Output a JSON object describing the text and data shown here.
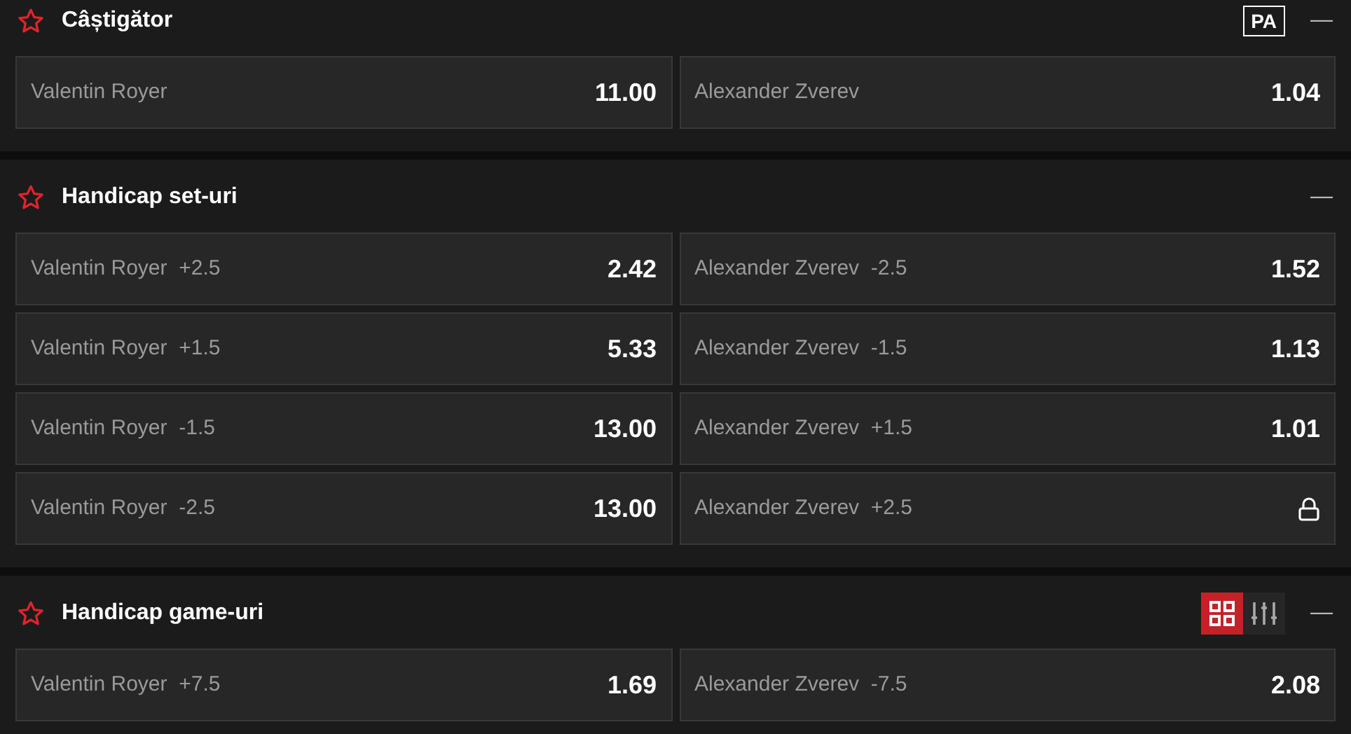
{
  "markets": [
    {
      "title": "Câștigător",
      "badge": "PA",
      "collapse": "—",
      "outcomes": [
        {
          "kind": "odds",
          "name": "Valentin Royer",
          "odds": "11.00"
        },
        {
          "kind": "odds",
          "name": "Alexander Zverev",
          "odds": "1.04"
        }
      ]
    },
    {
      "title": "Handicap set-uri",
      "collapse": "—",
      "outcomes": [
        {
          "kind": "odds",
          "name": "Valentin Royer",
          "line": "+2.5",
          "odds": "2.42"
        },
        {
          "kind": "odds",
          "name": "Alexander Zverev",
          "line": "-2.5",
          "odds": "1.52"
        },
        {
          "kind": "odds",
          "name": "Valentin Royer",
          "line": "+1.5",
          "odds": "5.33"
        },
        {
          "kind": "odds",
          "name": "Alexander Zverev",
          "line": "-1.5",
          "odds": "1.13"
        },
        {
          "kind": "odds",
          "name": "Valentin Royer",
          "line": "-1.5",
          "odds": "13.00"
        },
        {
          "kind": "odds",
          "name": "Alexander Zverev",
          "line": "+1.5",
          "odds": "1.01"
        },
        {
          "kind": "odds",
          "name": "Valentin Royer",
          "line": "-2.5",
          "odds": "13.00"
        },
        {
          "kind": "locked",
          "name": "Alexander Zverev",
          "line": "+2.5"
        }
      ]
    },
    {
      "title": "Handicap game-uri",
      "view_toggle": [
        {
          "kind": "grid",
          "selected": true
        },
        {
          "kind": "sliders",
          "selected": false
        }
      ],
      "collapse": "—",
      "outcomes": [
        {
          "kind": "odds",
          "name": "Valentin Royer",
          "line": "+7.5",
          "odds": "1.69"
        },
        {
          "kind": "odds",
          "name": "Alexander Zverev",
          "line": "-7.5",
          "odds": "2.08"
        }
      ]
    }
  ]
}
